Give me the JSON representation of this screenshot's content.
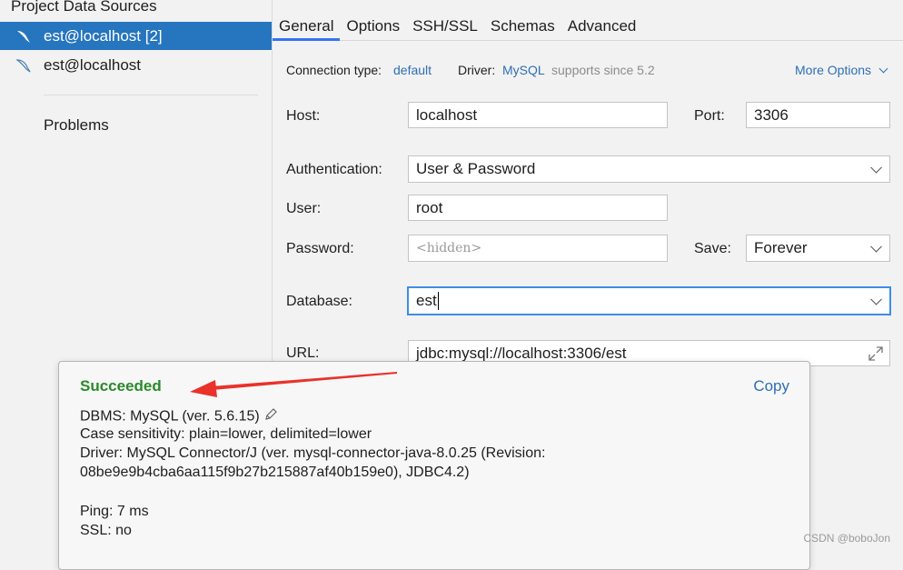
{
  "sidebar": {
    "title": "Project Data Sources",
    "items": [
      {
        "label": "est@localhost [2]",
        "icon": "mysql-dolphin-icon"
      },
      {
        "label": "est@localhost",
        "icon": "mysql-dolphin-icon"
      }
    ],
    "problems": "Problems"
  },
  "tabs": [
    "General",
    "Options",
    "SSH/SSL",
    "Schemas",
    "Advanced"
  ],
  "general": {
    "connection_type_label": "Connection type:",
    "connection_type_value": "default",
    "driver_label": "Driver:",
    "driver_value": "MySQL",
    "driver_note": "supports since 5.2",
    "more_options": "More Options",
    "host_label": "Host:",
    "host_value": "localhost",
    "port_label": "Port:",
    "port_value": "3306",
    "auth_label": "Authentication:",
    "auth_value": "User & Password",
    "user_label": "User:",
    "user_value": "root",
    "password_label": "Password:",
    "password_placeholder": "<hidden>",
    "save_label": "Save:",
    "save_value": "Forever",
    "database_label": "Database:",
    "database_value": "est",
    "url_label": "URL:",
    "url_value": "jdbc:mysql://localhost:3306/est"
  },
  "popup": {
    "status": "Succeeded",
    "copy": "Copy",
    "dbms": "DBMS: MySQL (ver. 5.6.15)",
    "case": "Case sensitivity: plain=lower, delimited=lower",
    "driver": "Driver: MySQL Connector/J (ver. mysql-connector-java-8.0.25 (Revision:",
    "revision": "08be9e9b4cba6aa115f9b27b215887af40b159e0), JDBC4.2)",
    "ping": "Ping: 7 ms",
    "ssl": "SSL: no"
  },
  "watermark": "CSDN @boboJon",
  "colors": {
    "selection": "#2675bf",
    "link": "#2e6fb4",
    "success": "#2a8a2a",
    "annotation_arrow": "#e8322a"
  }
}
